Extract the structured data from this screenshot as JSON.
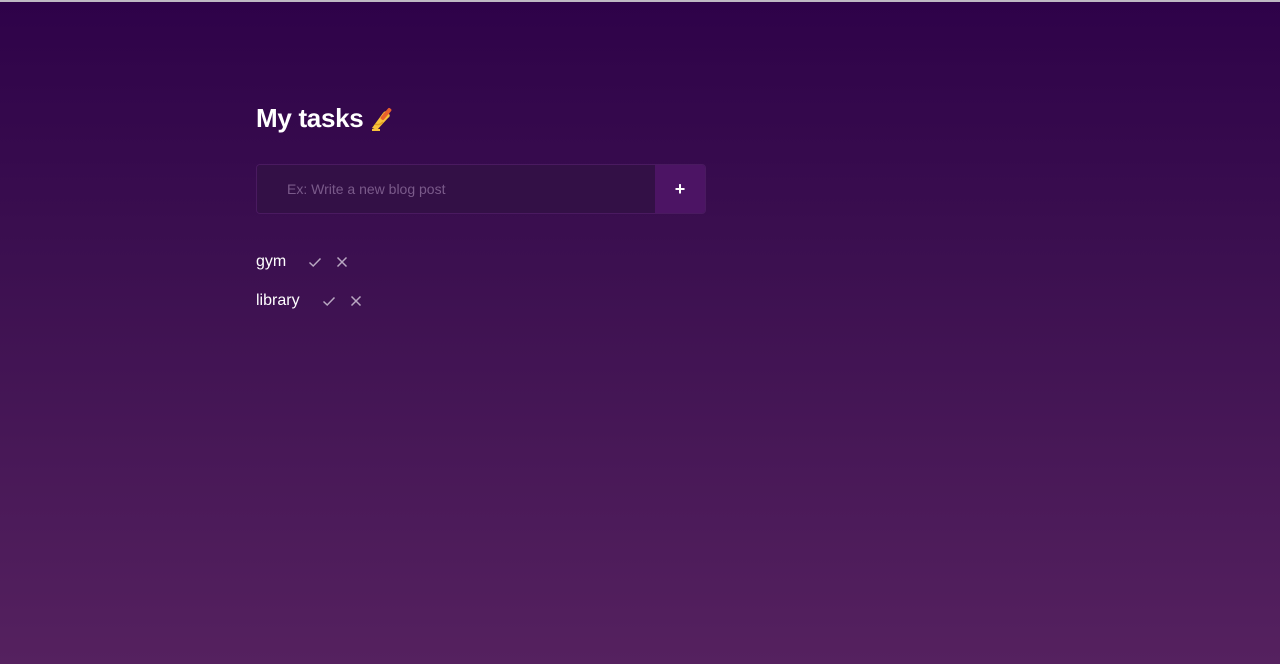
{
  "header": {
    "title": "My tasks",
    "emoji_icon": "writing-hand-icon"
  },
  "form": {
    "placeholder": "Ex: Write a new blog post",
    "value": "",
    "add_label": "+"
  },
  "tasks": [
    {
      "text": "gym",
      "done_icon": "check-icon",
      "delete_icon": "close-icon"
    },
    {
      "text": "library",
      "done_icon": "check-icon",
      "delete_icon": "close-icon"
    }
  ],
  "colors": {
    "background_top": "#2e0249",
    "background_bottom": "#55215f",
    "input_bg": "#331046",
    "button_bg": "#4c1464",
    "icon": "#b9a8c2"
  }
}
